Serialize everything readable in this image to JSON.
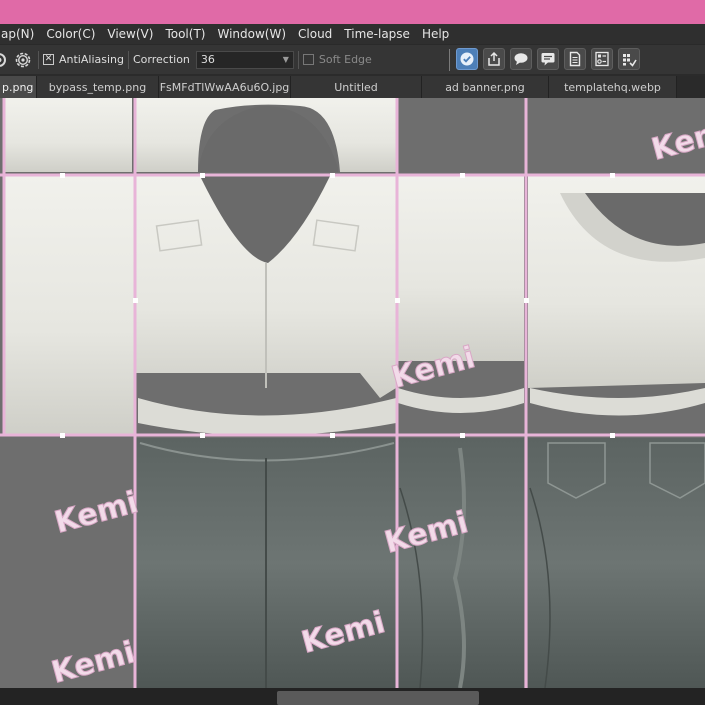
{
  "menu": {
    "items": [
      "ap(N)",
      "Color(C)",
      "View(V)",
      "Tool(T)",
      "Window(W)",
      "Cloud",
      "Time-lapse",
      "Help"
    ]
  },
  "toolbar": {
    "antialiasing_label": "AntiAliasing",
    "correction_label": "Correction",
    "correction_value": "36",
    "soft_edge_label": "Soft Edge"
  },
  "tabs": [
    {
      "label": "p.png",
      "active": true
    },
    {
      "label": "bypass_temp.png",
      "active": false
    },
    {
      "label": "FsMFdTlWwAA6u6O.jpg",
      "active": false
    },
    {
      "label": "Untitled",
      "active": false
    },
    {
      "label": "ad banner.png",
      "active": false
    },
    {
      "label": "templatehq.webp",
      "active": false
    }
  ],
  "canvas": {
    "watermark_text": "Kemi",
    "guide_color": "#e8b4d8",
    "background_color": "#6e6e6e",
    "shirt_color": "#e9e9e3",
    "pants_color": "#58615e"
  },
  "colors": {
    "titlebar": "#e06aa7",
    "accent": "#4d7fb8"
  }
}
